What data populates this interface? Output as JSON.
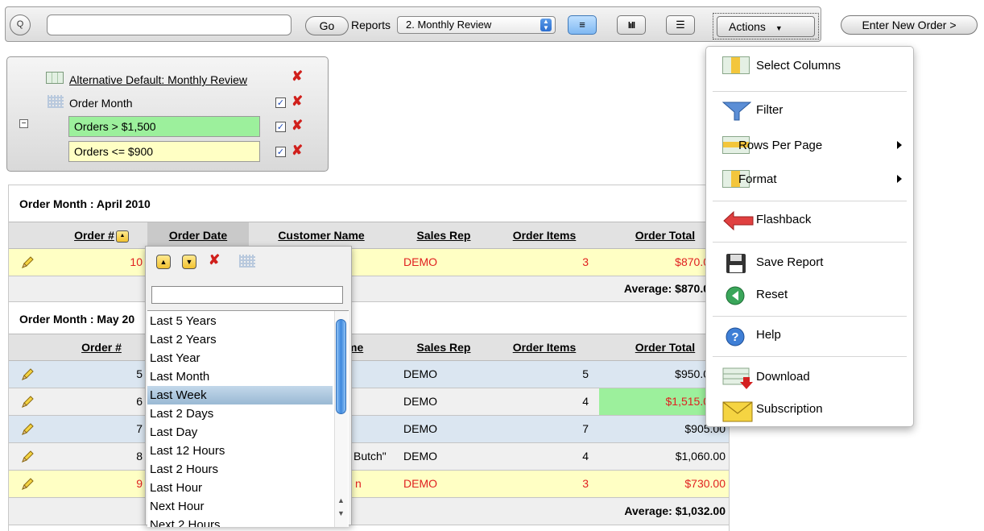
{
  "toolbar": {
    "go_label": "Go",
    "reports_label": "Reports",
    "report_selected": "2. Monthly Review",
    "actions_label": "Actions",
    "enter_new_order_label": "Enter New Order >"
  },
  "filters": {
    "report_name": "Alternative Default: Monthly Review",
    "group_by": "Order Month",
    "highlight1": "Orders > $1,500",
    "highlight2": "Orders <= $900"
  },
  "colors": {
    "highlight_green": "#9cf09c",
    "highlight_yellow": "#ffffc4",
    "row_blue": "#dbe6f1",
    "red_text": "#e02020"
  },
  "report": {
    "headers": [
      "Order #",
      "Order Date",
      "Customer Name",
      "Sales Rep",
      "Order Items",
      "Order Total"
    ],
    "groups": [
      {
        "title": "Order Month : April 2010",
        "rows": [
          {
            "order": "10",
            "customer": "",
            "rep": "DEMO",
            "items": "3",
            "total": "$870.0"
          }
        ],
        "average": "Average: $870.0"
      },
      {
        "title": "Order Month : May 20",
        "rows": [
          {
            "order": "5",
            "customer": "",
            "rep": "DEMO",
            "items": "5",
            "total": "$950.0"
          },
          {
            "order": "6",
            "customer": "",
            "rep": "DEMO",
            "items": "4",
            "total": "$1,515.0"
          },
          {
            "order": "7",
            "customer": "",
            "rep": "DEMO",
            "items": "7",
            "total": "$905.00"
          },
          {
            "order": "8",
            "customer": "Butch\"",
            "rep": "DEMO",
            "items": "4",
            "total": "$1,060.00"
          },
          {
            "order": "9",
            "customer": "n",
            "rep": "DEMO",
            "items": "3",
            "total": "$730.00"
          }
        ],
        "average": "Average: $1,032.00"
      }
    ],
    "group2_header_partial": "me"
  },
  "column_dropdown": {
    "filter_value": "",
    "options": [
      "Last 5 Years",
      "Last 2 Years",
      "Last Year",
      "Last Month",
      "Last Week",
      "Last 2 Days",
      "Last Day",
      "Last 12 Hours",
      "Last 2 Hours",
      "Last Hour",
      "Next Hour",
      "Next 2 Hours"
    ],
    "selected": "Last Week"
  },
  "actions_menu": {
    "items": [
      "Select Columns",
      "Filter",
      "Rows Per Page",
      "Format",
      "Flashback",
      "Save Report",
      "Reset",
      "Help",
      "Download",
      "Subscription"
    ]
  }
}
